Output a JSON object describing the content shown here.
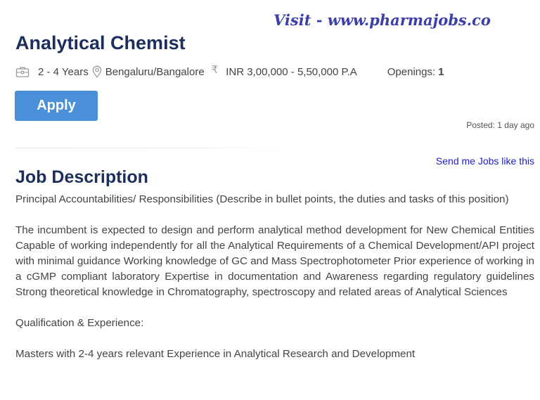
{
  "watermark": "Visit - www.pharmajobs.co",
  "job": {
    "title": "Analytical Chemist",
    "experience": "2 - 4 Years",
    "location": "Bengaluru/Bangalore",
    "salary": "INR 3,00,000 - 5,50,000 P.A",
    "openings_label": "Openings:",
    "openings_value": "1",
    "rupee_symbol": "₹"
  },
  "actions": {
    "apply_label": "Apply",
    "send_jobs_label": "Send me Jobs like this"
  },
  "posted": "Posted: 1 day ago",
  "description": {
    "heading": "Job Description",
    "paragraphs": [
      "Principal Accountabilities/ Responsibilities (Describe in bullet points, the duties and tasks of this position)",
      "The incumbent is expected to design and perform analytical method development for New Chemical Entities Capable of working independently for all the Analytical Requirements of a Chemical Development/API project with minimal guidance Working knowledge of GC and Mass Spectrophotometer Prior experience of working in a cGMP compliant laboratory Expertise in documentation and Awareness regarding regulatory guidelines Strong theoretical knowledge in Chromatography, spectroscopy and related areas of Analytical Sciences",
      "Qualification & Experience:",
      "Masters with 2-4 years relevant Experience in Analytical Research and Development"
    ]
  },
  "icons": {
    "experience": "briefcase-icon",
    "location": "location-pin-icon",
    "salary": "rupee-icon"
  },
  "colors": {
    "title": "#1c2e5c",
    "apply_button": "#4a90d9",
    "link": "#1e1ec8",
    "watermark": "#3b3fa8",
    "icon": "#9a9a9a"
  }
}
